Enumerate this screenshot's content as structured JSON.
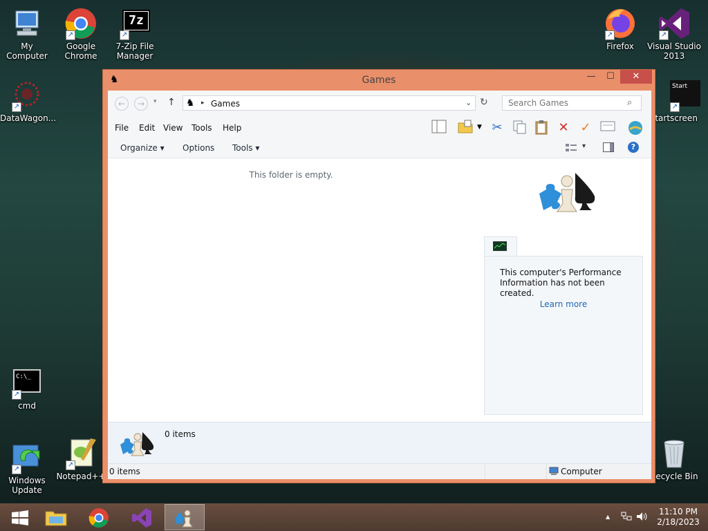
{
  "desktop": {
    "icons": [
      {
        "label": "My Computer",
        "icon": "computer-icon"
      },
      {
        "label": "Google Chrome",
        "icon": "chrome-icon"
      },
      {
        "label": "7-Zip File Manager",
        "icon": "7zip-icon"
      },
      {
        "label": "Firefox",
        "icon": "firefox-icon"
      },
      {
        "label": "Visual Studio 2013",
        "icon": "visual-studio-icon"
      },
      {
        "label": "DataWagon...",
        "icon": "datawagon-icon"
      },
      {
        "label": "startscreen",
        "icon": "startscreen-icon",
        "badge": "Start"
      },
      {
        "label": "cmd",
        "icon": "cmd-icon",
        "glyph": "C:\\_"
      },
      {
        "label": "Windows Update",
        "icon": "windows-update-icon"
      },
      {
        "label": "Notepad++",
        "icon": "notepadpp-icon"
      },
      {
        "label": "Recycle Bin",
        "icon": "recycle-bin-icon"
      }
    ],
    "sevenzip_glyph": "7z"
  },
  "window": {
    "title": "Games",
    "controls": {
      "minimize": "—",
      "maximize": "☐",
      "close": "✕"
    },
    "address": {
      "path": "Games",
      "separator": "▸"
    },
    "search": {
      "placeholder": "Search Games"
    },
    "menu": [
      "File",
      "Edit",
      "View",
      "Tools",
      "Help"
    ],
    "commands": {
      "organize": "Organize",
      "options": "Options",
      "tools": "Tools",
      "dropdown": "▾"
    },
    "content": {
      "empty_message": "This folder is empty."
    },
    "performance": {
      "message": "This computer's Performance Information has not been created.",
      "link": "Learn more"
    },
    "details": {
      "item_count": "0 items"
    },
    "status": {
      "items": "0 items",
      "zone": "Computer"
    }
  },
  "taskbar": {
    "time": "11:10 PM",
    "date": "2/18/2023",
    "tray": {
      "up_arrow": "▲"
    }
  },
  "colors": {
    "window_frame": "#e98f6a",
    "close_button": "#c7504a",
    "link": "#2166b5",
    "taskbar": "#5c4437"
  }
}
